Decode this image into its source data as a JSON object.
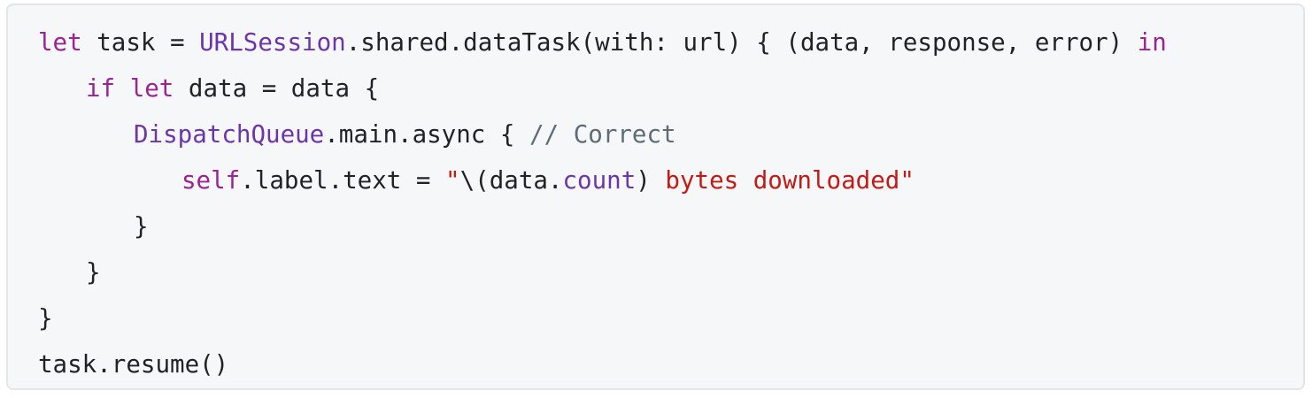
{
  "code": {
    "line1": {
      "kw_let": "let",
      "t1": " task = ",
      "type_urlsession": "URLSession",
      "t2": ".shared.dataTask(with: url) { (data, response, error) ",
      "kw_in": "in"
    },
    "line2": {
      "kw_if": "if",
      "t1": " ",
      "kw_let": "let",
      "t2": " data = data {"
    },
    "line3": {
      "type_dispatch": "DispatchQueue",
      "t1": ".main.async { ",
      "comment": "// Correct"
    },
    "line4": {
      "kw_self": "self",
      "t1": ".label.text = ",
      "str_open": "\"",
      "t2": "\\(data.",
      "prop_count": "count",
      "t3": ")",
      "str_rest": " bytes downloaded\""
    },
    "line5": {
      "t1": "}"
    },
    "line6": {
      "t1": "}"
    },
    "line7": {
      "t1": "}"
    },
    "line8": {
      "t1": "task.resume()"
    }
  },
  "colors": {
    "keyword": "#9b2393",
    "type": "#6c36a9",
    "comment": "#5d6c79",
    "string": "#c41a16",
    "plain": "#1f2328",
    "background": "#f6f7f9",
    "border": "#e3e5e8"
  }
}
